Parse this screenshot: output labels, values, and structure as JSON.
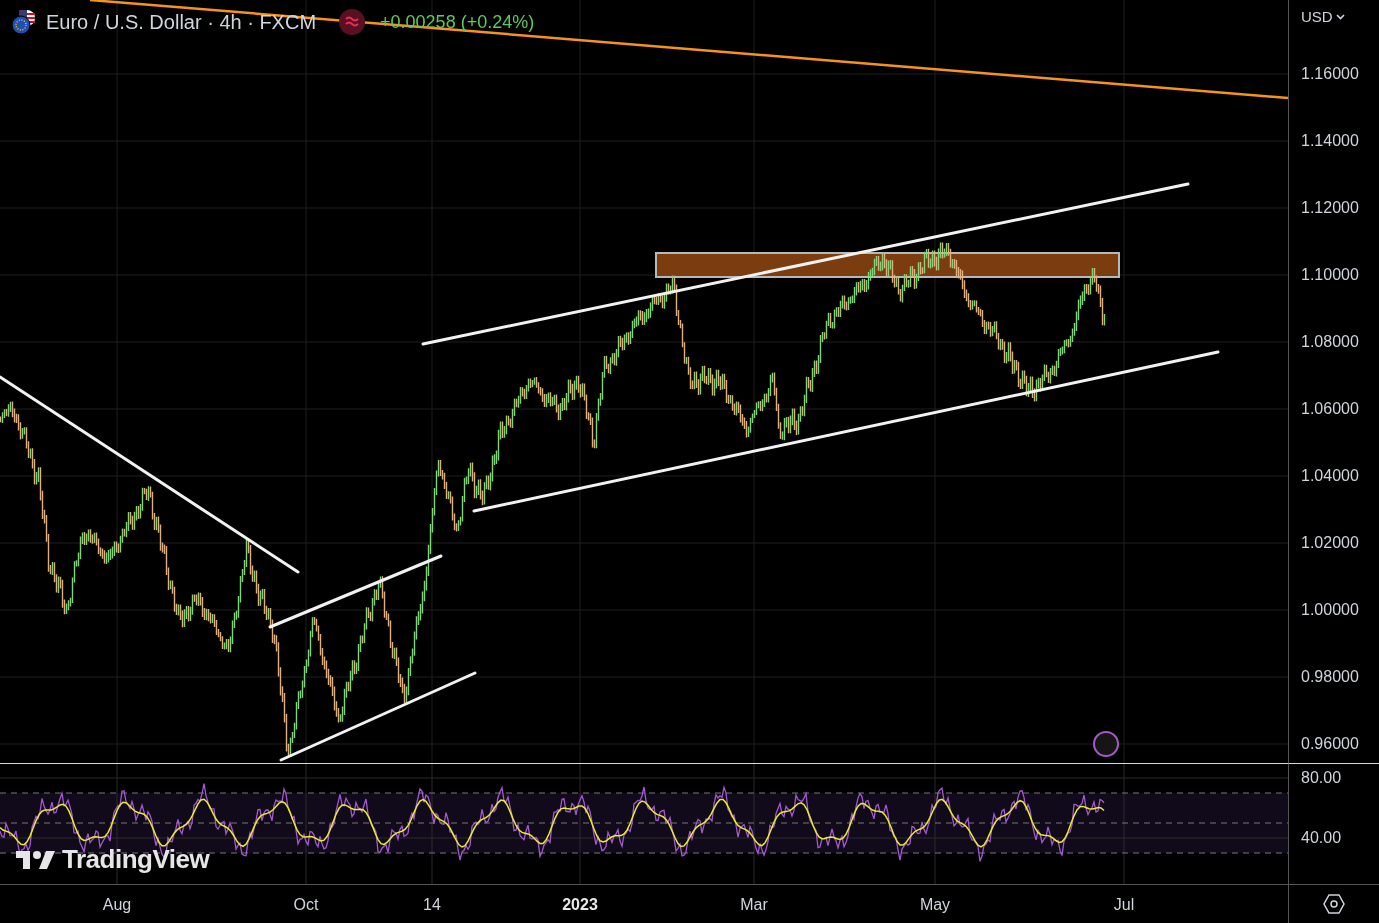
{
  "header": {
    "symbol": "Euro / U.S. Dollar · 4h · FXCM",
    "change": "+0.00258 (+0.24%)"
  },
  "currency_menu": {
    "label": "USD"
  },
  "price_axis": [
    "1.16000",
    "1.14000",
    "1.12000",
    "1.10000",
    "1.08000",
    "1.06000",
    "1.04000",
    "1.02000",
    "1.00000",
    "0.98000",
    "0.96000"
  ],
  "rsi_axis": [
    "80.00",
    "40.00"
  ],
  "time_axis": [
    {
      "label": "Aug",
      "bold": false
    },
    {
      "label": "Oct",
      "bold": false
    },
    {
      "label": "14",
      "bold": false
    },
    {
      "label": "2023",
      "bold": true
    },
    {
      "label": "Mar",
      "bold": false
    },
    {
      "label": "May",
      "bold": false
    },
    {
      "label": "Jul",
      "bold": false
    }
  ],
  "branding": {
    "logo_text": "TradingView"
  }
}
